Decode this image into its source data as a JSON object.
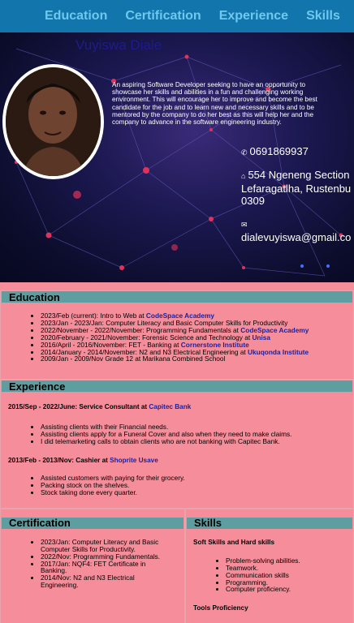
{
  "nav": {
    "items": [
      "Education",
      "Certification",
      "Experience",
      "Skills"
    ]
  },
  "hero": {
    "name": "Vuyiswa Diale",
    "bio": "An aspiring Software Developer seeking to have an opportunity to showcase her skills and abilities in a fun and challenging working environment. This will encourage her to improve and become the best candidate for the job and to learn new and necessary skills and to be mentored by the company to do her best as this will help her and the company to advance in the software engineering industry.",
    "phone": "0691869937",
    "address_line1": "554 Ngeneng Section",
    "address_line2": "Lefaragatlha, Rustenbu",
    "address_line3": "0309",
    "email": "dialevuyiswa@gmail.co"
  },
  "education": {
    "title": "Education",
    "items": [
      {
        "text": "2023/Feb (current): Intro to Web at ",
        "org": "CodeSpace Academy"
      },
      {
        "text": "2023/Jan - 2023/Jan: Computer Literacy and Basic Computer Skills for Productivity",
        "org": ""
      },
      {
        "text": "2022/November - 2022/November: Programming Fundamentals at ",
        "org": "CodeSpace Academy"
      },
      {
        "text": "2020/February - 2021/November: Forensic Science and Technology at ",
        "org": "Unisa"
      },
      {
        "text": "2016/April - 2016/November: FET - Banking at ",
        "org": "Cornerstone Institute"
      },
      {
        "text": "2014/January - 2014/November: N2 and N3 Electrical Engineering at ",
        "org": "Ukuqonda Institute"
      },
      {
        "text": "2009/Jan - 2009/Nov Grade 12 at Marikana Combined School",
        "org": ""
      }
    ]
  },
  "experience": {
    "title": "Experience",
    "jobs": [
      {
        "heading": "2015/Sep - 2022/June: Service Consultant at ",
        "company": "Capitec Bank",
        "duties": [
          "Assisting clients with their Financial needs.",
          "Assisting clients apply for a Funeral Cover and also when they need to make claims.",
          "I did telemarketing calls to obtain clients who are not banking with Capitec Bank."
        ]
      },
      {
        "heading": "2013/Feb - 2013/Nov: Cashier at ",
        "company": "Shoprite Usave",
        "duties": [
          "Assisted customers with paying for their grocery.",
          "Packing stock on the shelves.",
          "Stock taking done every quarter."
        ]
      }
    ]
  },
  "certification": {
    "title": "Certification",
    "items": [
      "2023/Jan: Computer Literacy and Basic Computer Skills for Productivity.",
      "2022/Nov: Programming Fundamentals.",
      "2017/Jan: NQF4: FET Certificate in Banking.",
      "2014/Nov: N2 and N3 Electrical Engineering."
    ]
  },
  "skills": {
    "title": "Skills",
    "soft_heading": "Soft Skills and Hard skills",
    "items": [
      "Problem-solving abilities.",
      "Teamwork.",
      "Communication skills",
      "Programming.",
      "Computer proficiency."
    ],
    "tools_heading": "Tools Proficiency"
  },
  "colors": {
    "nav": "#1276ad",
    "nav_text": "#6fc8ee",
    "section_bar": "#5f9ea0",
    "background": "#f58e9a",
    "org_text": "#20209a"
  },
  "icons": {
    "phone": "phone-icon",
    "address": "home-icon",
    "email": "envelope-icon"
  }
}
